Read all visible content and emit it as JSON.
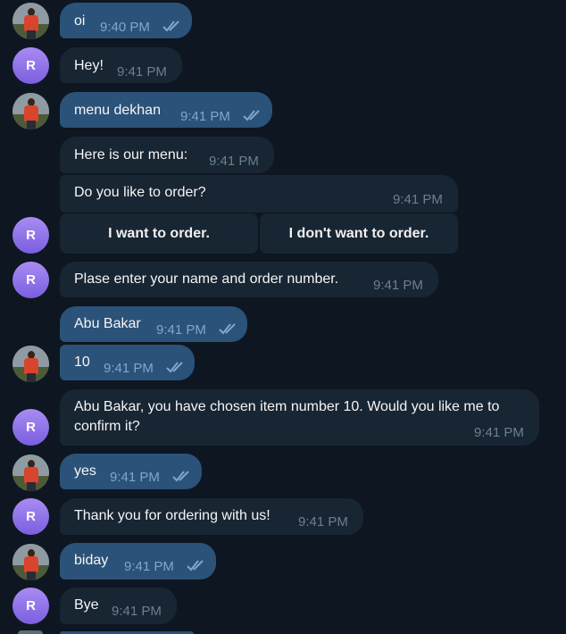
{
  "messages": [
    {
      "text": "oi",
      "time": "9:40 PM"
    },
    {
      "sender_initial": "R",
      "text": "Hey!",
      "time": "9:41 PM"
    },
    {
      "text": "menu dekhan",
      "time": "9:41 PM"
    },
    {
      "text": "Here is our menu:",
      "time": "9:41 PM"
    },
    {
      "text": "Do you like to order?",
      "time": "9:41 PM"
    },
    {
      "text": "Plase enter your name and order number.",
      "time": "9:41 PM"
    },
    {
      "text": "Abu Bakar",
      "time": "9:41 PM"
    },
    {
      "text": "10",
      "time": "9:41 PM"
    },
    {
      "text_line1": "Abu Bakar, you have chosen item number 10. Would you like me to",
      "text_line2": "confirm it?",
      "time": "9:41 PM"
    },
    {
      "text": "yes",
      "time": "9:41 PM"
    },
    {
      "text": "Thank you for ordering with us!",
      "time": "9:41 PM"
    },
    {
      "text": "biday",
      "time": "9:41 PM"
    },
    {
      "text": "Bye",
      "time": "9:41 PM"
    }
  ],
  "keyboard": {
    "order_yes": "I want to order.",
    "order_no": "I don't want to order."
  },
  "avatars": {
    "bot_initial": "R"
  },
  "colors": {
    "background": "#0e1621",
    "outgoing_bubble": "#2b5278",
    "incoming_bubble": "#182533",
    "bot_avatar": "#8a6ee8"
  }
}
